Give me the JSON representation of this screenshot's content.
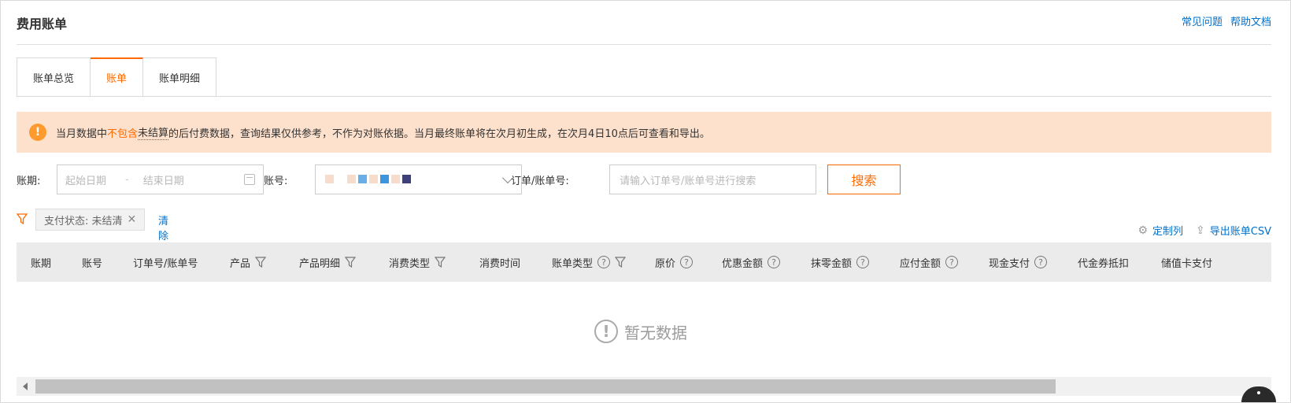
{
  "page": {
    "title": "费用账单",
    "links": [
      "常见问题",
      "帮助文档"
    ]
  },
  "tabs": [
    {
      "label": "账单总览",
      "active": false
    },
    {
      "label": "账单",
      "active": true
    },
    {
      "label": "账单明细",
      "active": false
    }
  ],
  "alert": {
    "text_1": "当月数据中",
    "text_em": "不包含",
    "text_dotted": "未结算",
    "text_2": "的后付费数据，查询结果仅供参考，不作为对账依据。当月最终账单将在次月初生成，在次月4日10点后可查看和导出。"
  },
  "filters": {
    "period_label": "账期:",
    "start_placeholder": "起始日期",
    "range_sep": "-",
    "end_placeholder": "结束日期",
    "account_label": "账号:",
    "order_label": "订单/账单号:",
    "order_placeholder": "请输入订单号/账单号进行搜索",
    "search_button": "搜索"
  },
  "active_filter": {
    "tag": "支付状态: 未结清",
    "clear_label": "清除"
  },
  "table_tools": {
    "customize": "定制列",
    "export": "导出账单CSV"
  },
  "table": {
    "columns": [
      {
        "label": "账期",
        "filter": false,
        "help": false
      },
      {
        "label": "账号",
        "filter": false,
        "help": false
      },
      {
        "label": "订单号/账单号",
        "filter": false,
        "help": false
      },
      {
        "label": "产品",
        "filter": true,
        "help": false
      },
      {
        "label": "产品明细",
        "filter": true,
        "help": false
      },
      {
        "label": "消费类型",
        "filter": true,
        "help": false
      },
      {
        "label": "消费时间",
        "filter": false,
        "help": false
      },
      {
        "label": "账单类型",
        "filter": true,
        "help": true
      },
      {
        "label": "原价",
        "filter": false,
        "help": true
      },
      {
        "label": "优惠金额",
        "filter": false,
        "help": true
      },
      {
        "label": "抹零金额",
        "filter": false,
        "help": true
      },
      {
        "label": "应付金额",
        "filter": false,
        "help": true
      },
      {
        "label": "现金支付",
        "filter": false,
        "help": true
      },
      {
        "label": "代金券抵扣",
        "filter": false,
        "help": false
      },
      {
        "label": "储值卡支付",
        "filter": false,
        "help": false
      }
    ],
    "empty_text": "暂无数据"
  },
  "colors": {
    "accent": "#ff6a00",
    "link": "#0070cc",
    "alert_bg": "#fde1cc",
    "alert_icon": "#ff9a2e"
  }
}
